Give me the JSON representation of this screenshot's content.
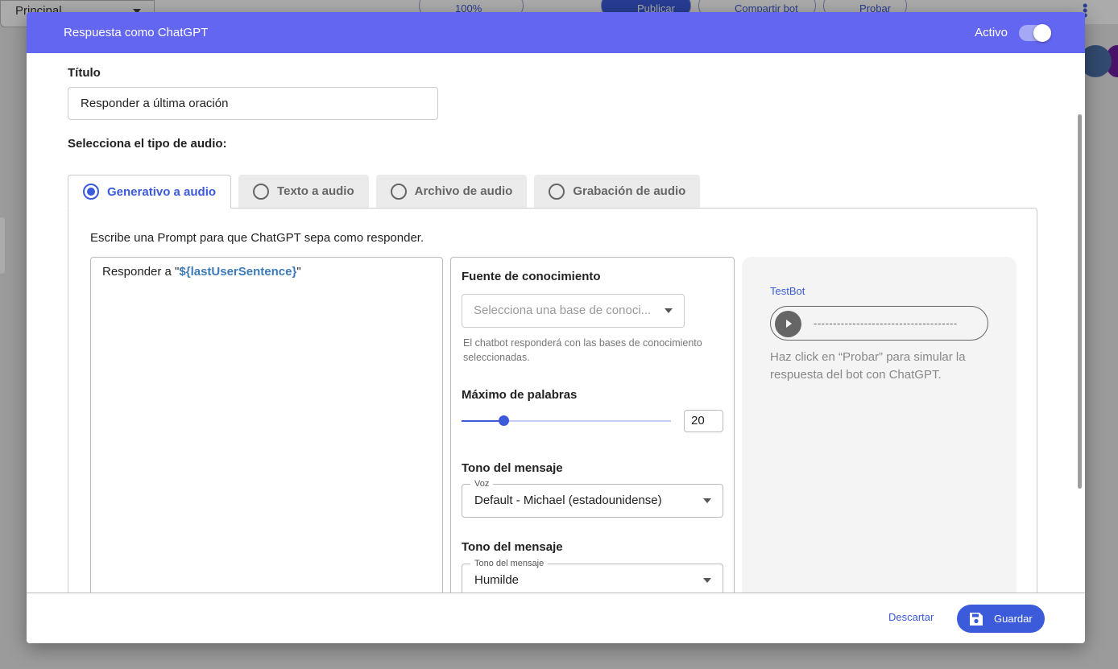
{
  "background": {
    "principal_label": "Principal",
    "zoom": "100%",
    "publish_label": "Publicar",
    "share_label": "Compartir bot",
    "test_label": "Probar"
  },
  "modal": {
    "title": "Respuesta como ChatGPT",
    "active_label": "Activo",
    "active": true
  },
  "form": {
    "title_label": "Título",
    "title_value": "Responder a última oración",
    "audio_type_label": "Selecciona el tipo de audio:",
    "tabs": [
      {
        "label": "Generativo a audio",
        "selected": true
      },
      {
        "label": "Texto a audio",
        "selected": false
      },
      {
        "label": "Archivo de audio",
        "selected": false
      },
      {
        "label": "Grabación de audio",
        "selected": false
      }
    ],
    "prompt_help": "Escribe una Prompt para que ChatGPT sepa como responder.",
    "prompt_prefix": "Responder a \"",
    "prompt_variable": "${lastUserSentence}",
    "prompt_suffix": "\""
  },
  "settings": {
    "knowledge_label": "Fuente de conocimiento",
    "knowledge_placeholder": "Selecciona una base de conoci...",
    "knowledge_help": "El chatbot responderá con las bases de conocimiento seleccionadas.",
    "max_words_label": "Máximo de palabras",
    "max_words_value": "20",
    "max_words_fraction": 0.2,
    "voice_section_label": "Tono del mensaje",
    "voice_float_label": "Voz",
    "voice_value": "Default - Michael (estadounidense)",
    "tone_section_label": "Tono del mensaje",
    "tone_float_label": "Tono del mensaje",
    "tone_value": "Humilde"
  },
  "preview": {
    "bot_label": "TestBot",
    "audio_placeholder": "-------------------------------------",
    "help": "Haz click en “Probar” para simular la respuesta del bot con ChatGPT."
  },
  "footer": {
    "discard_label": "Descartar",
    "save_label": "Guardar"
  },
  "colors": {
    "header": "#6366f1",
    "accent": "#3b5bdb"
  }
}
